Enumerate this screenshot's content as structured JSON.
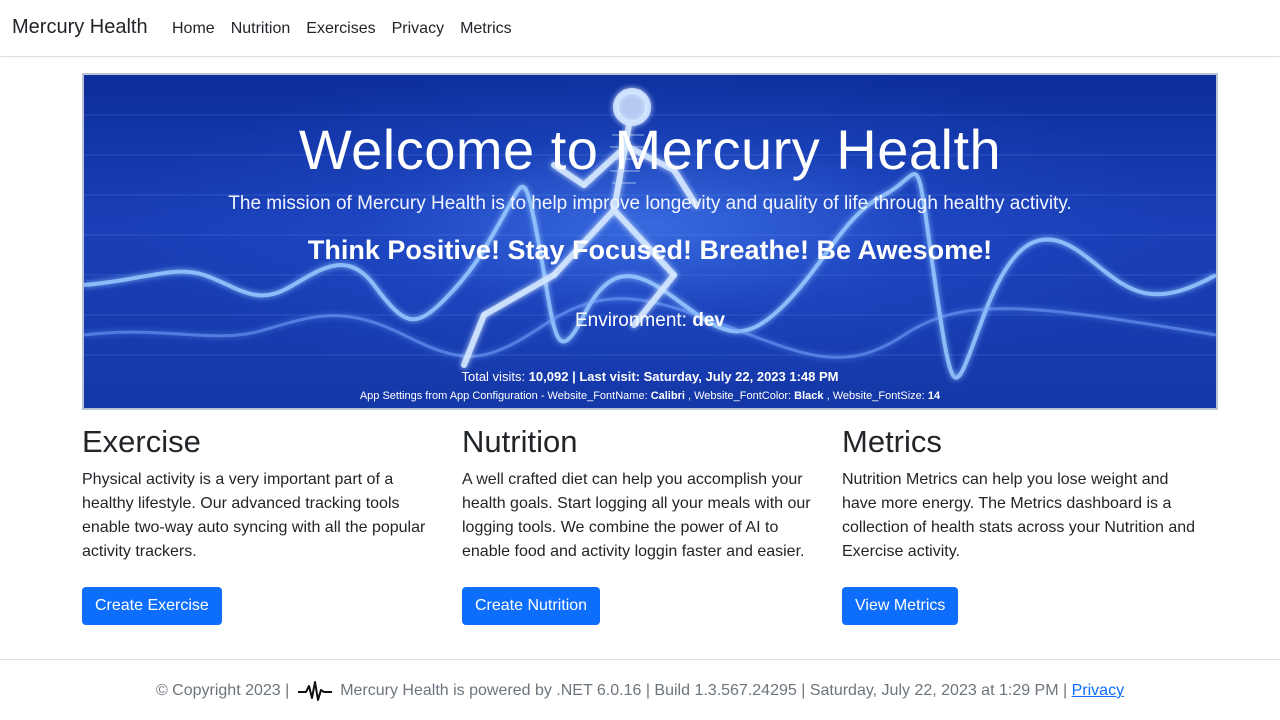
{
  "nav": {
    "brand": "Mercury Health",
    "links": [
      "Home",
      "Nutrition",
      "Exercises",
      "Privacy",
      "Metrics"
    ]
  },
  "hero": {
    "title": "Welcome to Mercury Health",
    "mission": "The mission of Mercury Health is to help improve longevity and quality of life through healthy activity.",
    "slogan": "Think Positive! Stay Focused! Breathe! Be Awesome!",
    "environment_label": "Environment:",
    "environment_value": "dev",
    "visits_label": "Total visits:",
    "visits_value": "10,092",
    "last_visit_label": "| Last visit:",
    "last_visit_value": "Saturday, July 22, 2023 1:48 PM",
    "settings_prefix": "App Settings from App Configuration - Website_FontName:",
    "font_name": "Calibri",
    "font_color_label": ", Website_FontColor:",
    "font_color": "Black",
    "font_size_label": ", Website_FontSize:",
    "font_size": "14"
  },
  "sections": [
    {
      "heading": "Exercise",
      "text": "Physical activity is a very important part of a healthy lifestyle. Our advanced tracking tools enable two-way auto syncing with all the popular activity trackers.",
      "button": "Create Exercise"
    },
    {
      "heading": "Nutrition",
      "text": "A well crafted diet can help you accomplish your health goals. Start logging all your meals with our logging tools. We combine the power of AI to enable food and activity loggin faster and easier.",
      "button": "Create Nutrition"
    },
    {
      "heading": "Metrics",
      "text": "Nutrition Metrics can help you lose weight and have more energy. The Metrics dashboard is a collection of health stats across your Nutrition and Exercise activity.",
      "button": "View Metrics"
    }
  ],
  "footer": {
    "copyright": "© Copyright 2023 |",
    "icon": "heartbeat-pulse-icon",
    "info": "Mercury Health is powered by .NET 6.0.16 | Build 1.3.567.24295 | Saturday, July 22, 2023 at 1:29 PM |",
    "privacy_link": "Privacy"
  },
  "colors": {
    "primary_button": "#0d6efd",
    "hero_blue": "#1a3fb8",
    "footer_text": "#6c757d"
  }
}
